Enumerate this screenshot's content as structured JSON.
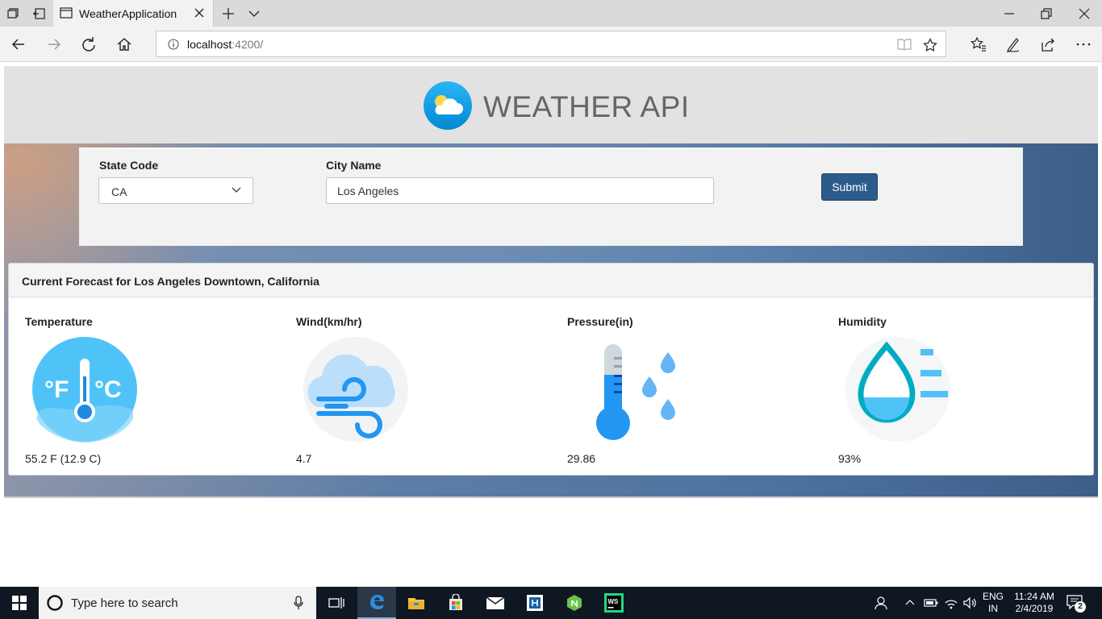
{
  "browser": {
    "tab_title": "WeatherApplication",
    "url_host": "localhost",
    "url_port": ":4200/"
  },
  "header": {
    "title": "WEATHER API"
  },
  "form": {
    "state_label": "State Code",
    "state_value": "CA",
    "city_label": "City Name",
    "city_value": "Los Angeles",
    "submit_label": "Submit"
  },
  "forecast": {
    "title": "Current Forecast for Los Angeles Downtown, California",
    "metrics": [
      {
        "name": "Temperature",
        "value": "55.2 F (12.9 C)",
        "icon": "thermometer-fahrenheit-celsius-icon"
      },
      {
        "name": "Wind(km/hr)",
        "value": "4.7",
        "icon": "wind-cloud-icon"
      },
      {
        "name": "Pressure(in)",
        "value": "29.86",
        "icon": "pressure-thermometer-drops-icon"
      },
      {
        "name": "Humidity",
        "value": "93%",
        "icon": "humidity-drop-icon"
      }
    ]
  },
  "taskbar": {
    "search_placeholder": "Type here to search",
    "language_line1": "ENG",
    "language_line2": "IN",
    "time": "11:24 AM",
    "date": "2/4/2019",
    "notification_count": "2"
  },
  "colors": {
    "submit_button": "#2b5b8b",
    "header_bg": "#e2e2e2",
    "taskbar_bg": "#0e1722",
    "icon_blue": "#2196f3"
  }
}
